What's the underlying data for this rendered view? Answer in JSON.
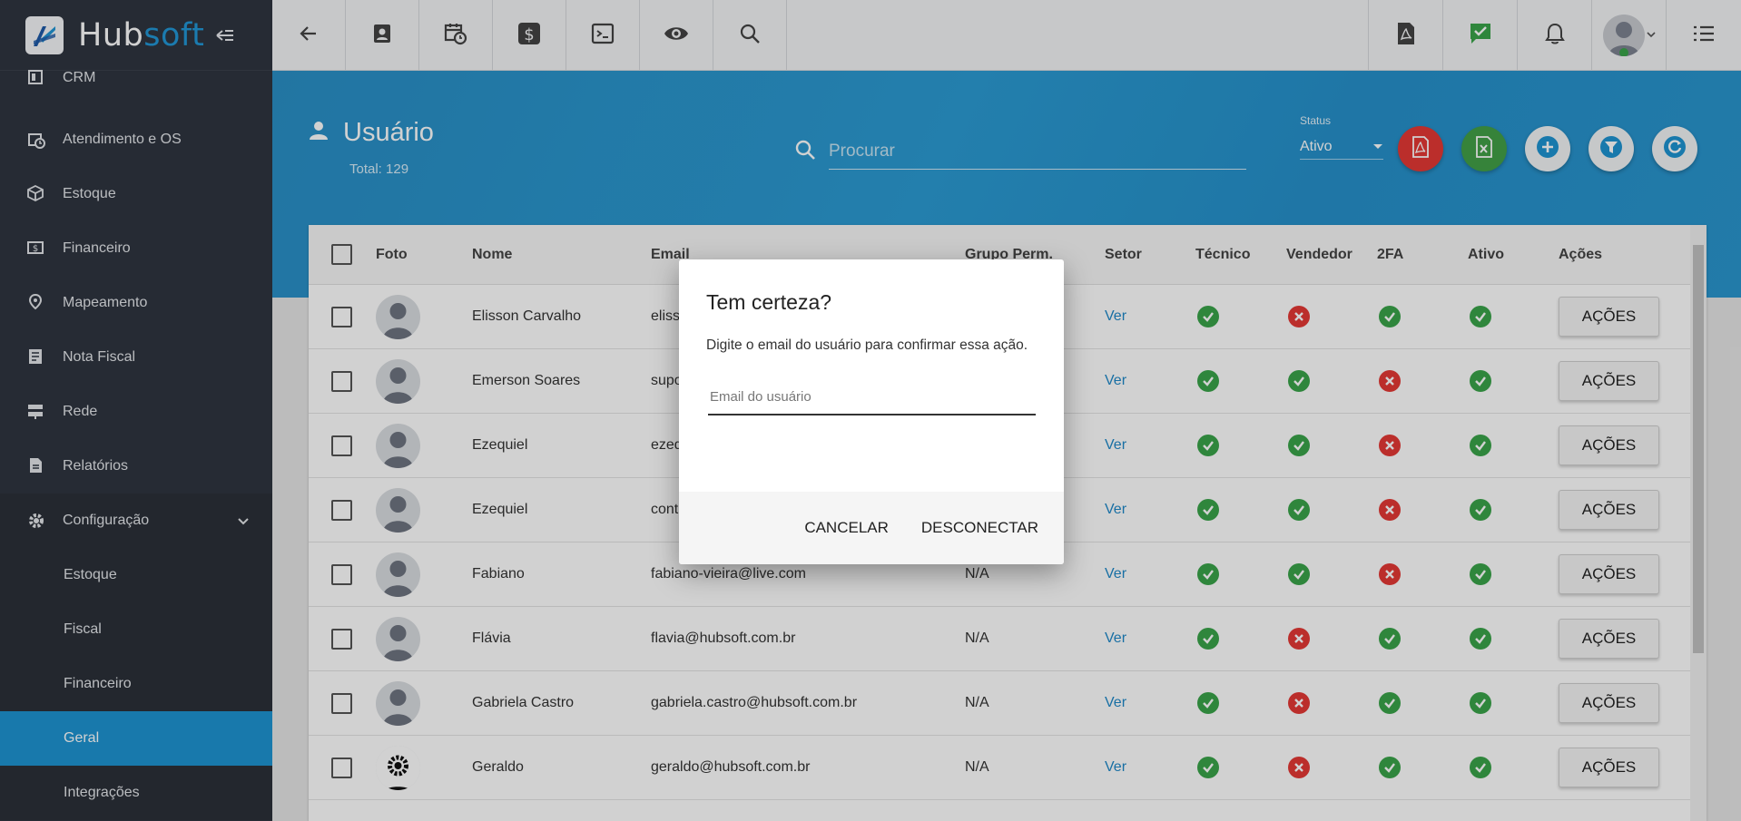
{
  "brand": {
    "name_part1": "Hub",
    "name_part2": "soft"
  },
  "sidebar": {
    "items": [
      {
        "label": "CRM",
        "icon": "crm-icon"
      },
      {
        "label": "Atendimento e OS",
        "icon": "calendar-clock-icon"
      },
      {
        "label": "Estoque",
        "icon": "box-icon"
      },
      {
        "label": "Financeiro",
        "icon": "money-icon"
      },
      {
        "label": "Mapeamento",
        "icon": "map-pin-icon"
      },
      {
        "label": "Nota Fiscal",
        "icon": "document-icon"
      },
      {
        "label": "Rede",
        "icon": "server-icon"
      },
      {
        "label": "Relatórios",
        "icon": "report-icon"
      },
      {
        "label": "Configuração",
        "icon": "gear-icon"
      }
    ],
    "subitems": [
      {
        "label": "Estoque"
      },
      {
        "label": "Fiscal"
      },
      {
        "label": "Financeiro"
      },
      {
        "label": "Geral",
        "active": true
      },
      {
        "label": "Integrações"
      }
    ]
  },
  "header": {
    "title": "Usuário",
    "total": "Total: 129",
    "search_placeholder": "Procurar",
    "status_label": "Status",
    "status_value": "Ativo"
  },
  "table": {
    "columns": {
      "foto": "Foto",
      "nome": "Nome",
      "email": "Email",
      "grupo": "Grupo Perm.",
      "setor": "Setor",
      "tecnico": "Técnico",
      "vendedor": "Vendedor",
      "twofa": "2FA",
      "ativo": "Ativo",
      "acoes": "Ações"
    },
    "setor_link": "Ver",
    "action_label": "AÇÕES",
    "rows": [
      {
        "nome": "Elisson Carvalho",
        "email": "eliss",
        "grupo": "",
        "tecnico": true,
        "vendedor": false,
        "twofa": true,
        "ativo": true
      },
      {
        "nome": "Emerson Soares",
        "email": "supo",
        "grupo": "",
        "tecnico": true,
        "vendedor": true,
        "twofa": false,
        "ativo": true
      },
      {
        "nome": "Ezequiel",
        "email": "ezeq",
        "grupo": "",
        "tecnico": true,
        "vendedor": true,
        "twofa": false,
        "ativo": true
      },
      {
        "nome": "Ezequiel",
        "email": "cont",
        "grupo": "",
        "tecnico": true,
        "vendedor": true,
        "twofa": false,
        "ativo": true
      },
      {
        "nome": "Fabiano",
        "email": "fabiano-vieira@live.com",
        "grupo": "N/A",
        "tecnico": true,
        "vendedor": true,
        "twofa": false,
        "ativo": true
      },
      {
        "nome": "Flávia",
        "email": "flavia@hubsoft.com.br",
        "grupo": "N/A",
        "tecnico": true,
        "vendedor": false,
        "twofa": true,
        "ativo": true
      },
      {
        "nome": "Gabriela Castro",
        "email": "gabriela.castro@hubsoft.com.br",
        "grupo": "N/A",
        "tecnico": true,
        "vendedor": false,
        "twofa": true,
        "ativo": true
      },
      {
        "nome": "Geraldo",
        "email": "geraldo@hubsoft.com.br",
        "grupo": "N/A",
        "tecnico": true,
        "vendedor": false,
        "twofa": true,
        "ativo": true
      }
    ]
  },
  "dialog": {
    "title": "Tem certeza?",
    "message": "Digite o email do usuário para confirmar essa ação.",
    "input_placeholder": "Email do usuário",
    "cancel_label": "CANCELAR",
    "confirm_label": "DESCONECTAR"
  },
  "colors": {
    "sidebar_bg": "#2f3540",
    "accent": "#1e94d2",
    "success": "#3aa44a",
    "danger": "#e53935",
    "pdf_red": "#e53935",
    "excel_green": "#43a047"
  }
}
